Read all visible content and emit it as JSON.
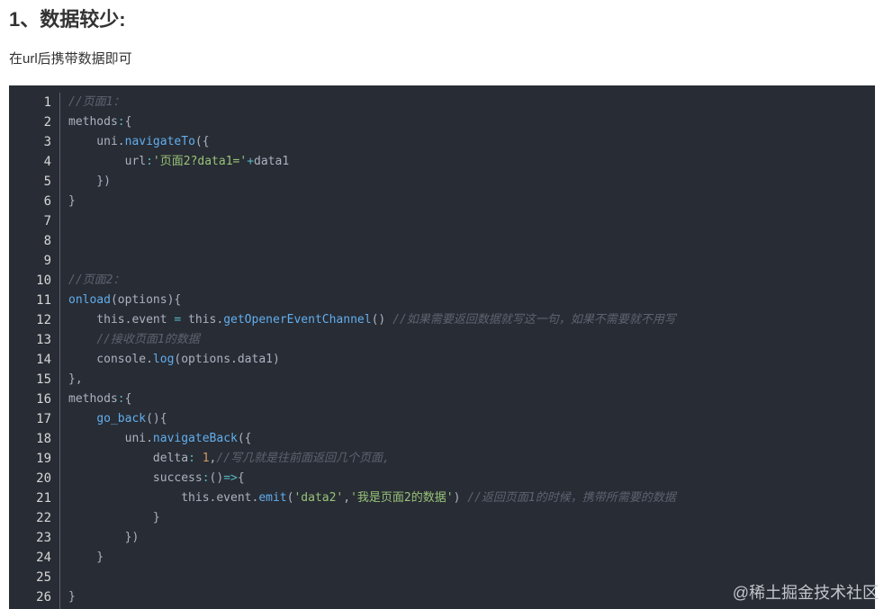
{
  "heading": "1、数据较少:",
  "paragraph": "在url后携带数据即可",
  "watermark": "@稀土掘金技术社区",
  "code": {
    "lines": [
      [
        {
          "t": "//页面1：",
          "c": "com"
        }
      ],
      [
        {
          "t": "methods"
        },
        {
          "t": ":",
          "c": "op"
        },
        {
          "t": "{"
        }
      ],
      [
        {
          "t": "    uni."
        },
        {
          "t": "navigateTo",
          "c": "fn"
        },
        {
          "t": "({"
        }
      ],
      [
        {
          "t": "        url"
        },
        {
          "t": ":",
          "c": "op"
        },
        {
          "t": "'页面2?data1='",
          "c": "str"
        },
        {
          "t": "+",
          "c": "op"
        },
        {
          "t": "data1"
        }
      ],
      [
        {
          "t": "    })"
        }
      ],
      [
        {
          "t": "}"
        }
      ],
      [
        {
          "t": ""
        }
      ],
      [
        {
          "t": ""
        }
      ],
      [
        {
          "t": ""
        }
      ],
      [
        {
          "t": "//页面2：",
          "c": "com"
        }
      ],
      [
        {
          "t": "onload",
          "c": "fn"
        },
        {
          "t": "(options){"
        }
      ],
      [
        {
          "t": "    this.event "
        },
        {
          "t": "=",
          "c": "op"
        },
        {
          "t": " this."
        },
        {
          "t": "getOpenerEventChannel",
          "c": "fn"
        },
        {
          "t": "() "
        },
        {
          "t": "//如果需要返回数据就写这一句，如果不需要就不用写",
          "c": "com"
        }
      ],
      [
        {
          "t": "    "
        },
        {
          "t": "//接收页面1的数据",
          "c": "com"
        }
      ],
      [
        {
          "t": "    console."
        },
        {
          "t": "log",
          "c": "fn"
        },
        {
          "t": "(options.data1)"
        }
      ],
      [
        {
          "t": "},"
        }
      ],
      [
        {
          "t": "methods"
        },
        {
          "t": ":",
          "c": "op"
        },
        {
          "t": "{"
        }
      ],
      [
        {
          "t": "    "
        },
        {
          "t": "go_back",
          "c": "fn"
        },
        {
          "t": "(){"
        }
      ],
      [
        {
          "t": "        uni."
        },
        {
          "t": "navigateBack",
          "c": "fn"
        },
        {
          "t": "({"
        }
      ],
      [
        {
          "t": "            delta"
        },
        {
          "t": ":",
          "c": "op"
        },
        {
          "t": " "
        },
        {
          "t": "1",
          "c": "num"
        },
        {
          "t": ","
        },
        {
          "t": "//写几就是往前面返回几个页面,",
          "c": "com"
        }
      ],
      [
        {
          "t": "            success"
        },
        {
          "t": ":",
          "c": "op"
        },
        {
          "t": "()"
        },
        {
          "t": "=>",
          "c": "op"
        },
        {
          "t": "{"
        }
      ],
      [
        {
          "t": "                this.event."
        },
        {
          "t": "emit",
          "c": "fn"
        },
        {
          "t": "("
        },
        {
          "t": "'data2'",
          "c": "str"
        },
        {
          "t": ","
        },
        {
          "t": "'我是页面2的数据'",
          "c": "str"
        },
        {
          "t": ") "
        },
        {
          "t": "//返回页面1的时候，携带所需要的数据",
          "c": "com"
        }
      ],
      [
        {
          "t": "            }"
        }
      ],
      [
        {
          "t": "        })"
        }
      ],
      [
        {
          "t": "    }"
        }
      ],
      [
        {
          "t": ""
        }
      ],
      [
        {
          "t": "}"
        }
      ]
    ]
  }
}
